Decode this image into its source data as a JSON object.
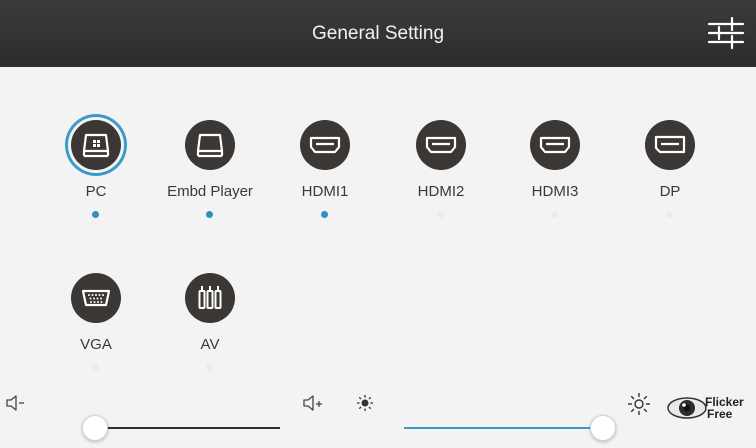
{
  "header": {
    "title": "General Setting"
  },
  "sources": [
    {
      "label": "PC",
      "icon": "pc-icon",
      "active": true,
      "selected": true
    },
    {
      "label": "Embd Player",
      "icon": "embedded-player-icon",
      "active": true,
      "selected": false
    },
    {
      "label": "HDMI1",
      "icon": "hdmi-icon",
      "active": true,
      "selected": false
    },
    {
      "label": "HDMI2",
      "icon": "hdmi-icon",
      "active": false,
      "selected": false
    },
    {
      "label": "HDMI3",
      "icon": "hdmi-icon",
      "active": false,
      "selected": false
    },
    {
      "label": "DP",
      "icon": "displayport-icon",
      "active": false,
      "selected": false
    },
    {
      "label": "VGA",
      "icon": "vga-icon",
      "active": false,
      "selected": false
    },
    {
      "label": "AV",
      "icon": "av-icon",
      "active": false,
      "selected": false
    }
  ],
  "volume": {
    "level": 0,
    "down_icon": "volume-down-icon",
    "up_icon": "volume-up-icon"
  },
  "brightness": {
    "level": 100,
    "low_icon": "brightness-low-icon",
    "high_icon": "brightness-high-icon"
  },
  "flicker_free": {
    "line1": "Flicker",
    "line2": "Free",
    "icon": "eye-icon"
  },
  "colors": {
    "header": "#2f2f2f",
    "accent": "#3a9cc4",
    "icon_bg": "#3b3735",
    "background": "#f3f3f3"
  }
}
